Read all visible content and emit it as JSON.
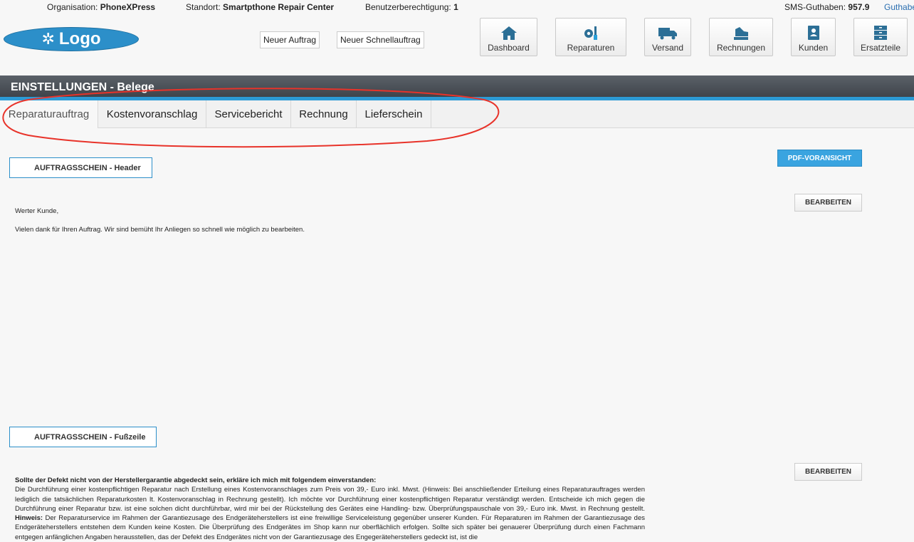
{
  "infobar": {
    "org_label": "Organisation:",
    "org_value": "PhoneXPress",
    "site_label": "Standort:",
    "site_value": "Smartpthone Repair Center",
    "perm_label": "Benutzerberechtigung:",
    "perm_value": "1",
    "sms_label": "SMS-Guthaben:",
    "sms_value": "957.9",
    "credit_link": "Guthabe"
  },
  "logo": {
    "text": "Logo"
  },
  "actions": {
    "new_order": "Neuer Auftrag",
    "new_quick_order": "Neuer Schnellauftrag"
  },
  "nav": {
    "dashboard": "Dashboard",
    "repairs": "Reparaturen",
    "shipping": "Versand",
    "invoices": "Rechnungen",
    "customers": "Kunden",
    "parts": "Ersatzteile"
  },
  "page_title": "EINSTELLUNGEN - Belege",
  "tabs": {
    "t0": "Reparaturauftrag",
    "t1": "Kostenvoranschlag",
    "t2": "Servicebericht",
    "t3": "Rechnung",
    "t4": "Lieferschein"
  },
  "header_section": {
    "title": "AUFTRAGSSCHEIN - Header",
    "pdf_button": "PDF-VORANSICHT",
    "edit_button": "BEARBEITEN",
    "greeting": "Werter Kunde,",
    "message": "Vielen dank für Ihren Auftrag. Wir sind bemüht Ihr Anliegen so schnell wie möglich zu bearbeiten."
  },
  "footer_section": {
    "title": "AUFTRAGSSCHEIN - Fußzeile",
    "edit_button": "BEARBEITEN",
    "heading": "Sollte der Defekt nicht von der Herstellergarantie abgedeckt sein, erkläre ich mich mit folgendem einverstanden:",
    "para1": "Die Durchführung einer kostenpflichtigen Reparatur nach Erstellung eines Kostenvoranschlages zum Preis von 39,- Euro inkl. Mwst. (Hinweis: Bei anschließender Erteilung eines Reparaturauftrages werden lediglich die tatsächlichen Reparaturkosten lt. Kostenvoranschlag in Rechnung gestellt). Ich möchte vor Durchführung einer kostenpflichtigen Reparatur verständigt werden. Entscheide ich mich gegen die Durchführung einer Reparatur bzw. ist eine solchen dicht durchführbar, wird mir bei der Rückstellung des Gerätes eine Handling- bzw. Überprüfungspauschale von 39,- Euro ink. Mwst. in Rechnung gestellt.",
    "hint_label": "Hinweis:",
    "para2": "Der Reparaturservice im Rahmen der Garantiezusage des Endgeräteherstellers ist eine freiwillige Serviceleistung gegenüber unserer Kunden. Für Reparaturen im Rahmen der Garantiezusage des Endgeräteherstellers entstehen dem Kunden keine Kosten. Die Überprüfung des Endgerätes im Shop kann nur oberflächlich erfolgen. Sollte sich später bei genauerer Überprüfung durch einen Fachmann entgegen anfänglichen Angaben herausstellen, das der Defekt des Endgerätes nicht von der Garantiezusage des Engegeräteherstellers gedeckt ist, ist die"
  },
  "colors": {
    "accent": "#2c9ad5",
    "titlebar": "#4a4f56",
    "annotation": "#e8332a"
  }
}
